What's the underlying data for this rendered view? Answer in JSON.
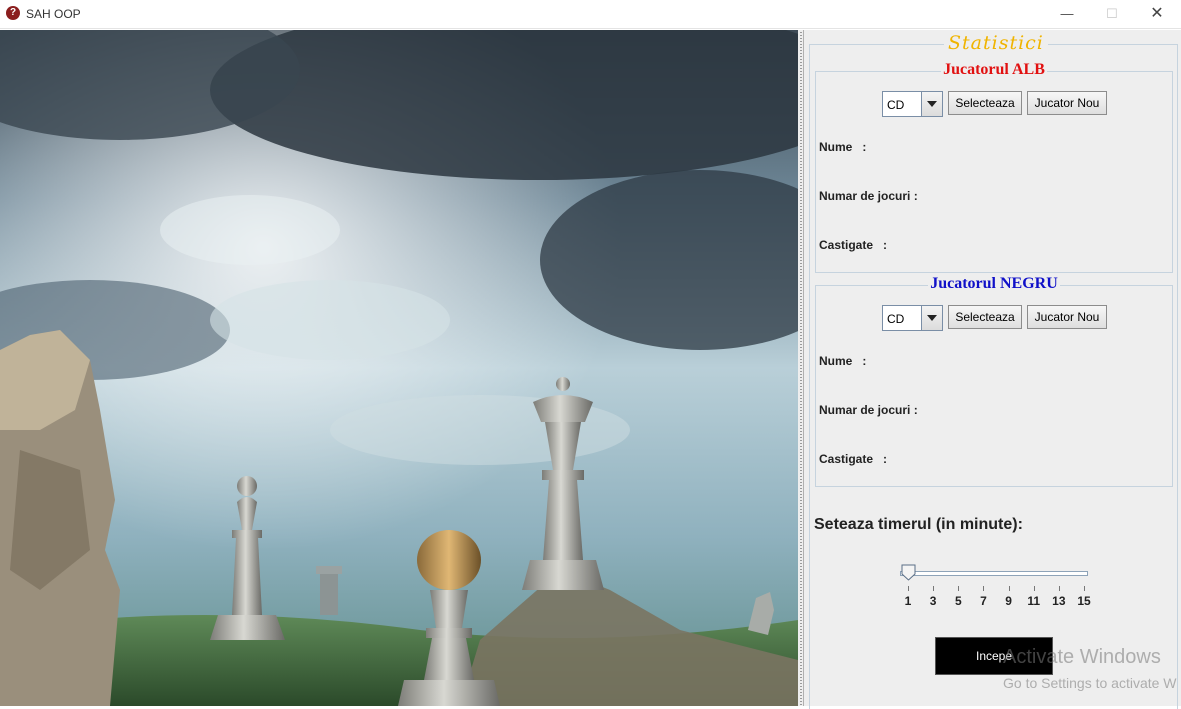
{
  "window": {
    "title": "SAH OOP",
    "icon_glyph": "?",
    "minimize_glyph": "—",
    "maximize_glyph": "☐",
    "close_glyph": "✕"
  },
  "stats": {
    "title": "Statistici",
    "white_player": {
      "title": "Jucatorul ALB",
      "title_color": "#e11010",
      "combo_value": "CD",
      "select_label": "Selecteaza",
      "new_player_label": "Jucator Nou",
      "name_label": "Nume   :",
      "games_label": "Numar de jocuri :",
      "wins_label": "Castigate   :"
    },
    "black_player": {
      "title": "Jucatorul NEGRU",
      "title_color": "#1010c8",
      "combo_value": "CD",
      "select_label": "Selecteaza",
      "new_player_label": "Jucator Nou",
      "name_label": "Nume   :",
      "games_label": "Numar de jocuri :",
      "wins_label": "Castigate   :"
    }
  },
  "timer": {
    "label": "Seteaza timerul (in minute):",
    "min": 1,
    "max": 15,
    "value": 1,
    "tick_labels": [
      "1",
      "3",
      "5",
      "7",
      "9",
      "11",
      "13",
      "15"
    ]
  },
  "start_button": {
    "label": "Incepe"
  },
  "watermark": {
    "line1": "Activate Windows",
    "line2": "Go to Settings to activate W"
  },
  "colors": {
    "panel_bg": "#eeeeee",
    "stats_title": "#f0b400",
    "start_bg": "#000000"
  }
}
